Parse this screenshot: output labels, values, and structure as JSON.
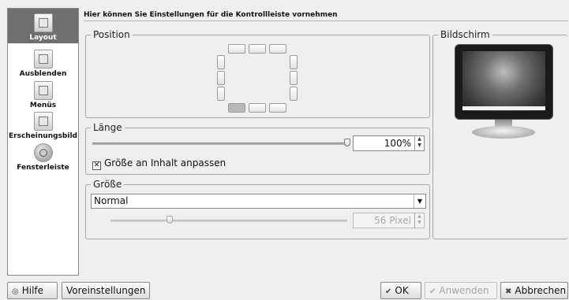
{
  "header": {
    "text": "Hier können Sie Einstellungen für die Kontrollleiste vornehmen"
  },
  "sidebar": {
    "items": [
      {
        "label": "Layout",
        "icon": "layout-icon",
        "selected": true
      },
      {
        "label": "Ausblenden",
        "icon": "hide-icon",
        "selected": false
      },
      {
        "label": "Menüs",
        "icon": "menus-icon",
        "selected": false
      },
      {
        "label": "Erscheinungsbild",
        "icon": "appearance-icon",
        "selected": false
      },
      {
        "label": "Fensterleiste",
        "icon": "taskbar-icon",
        "selected": false
      }
    ]
  },
  "position": {
    "title": "Position",
    "selected": "bottom-left"
  },
  "screen": {
    "title": "Bildschirm"
  },
  "length": {
    "title": "Länge",
    "value": "100%",
    "slider_fraction": 1.0,
    "fit_content_label": "Größe an Inhalt anpassen",
    "fit_content_checked": true
  },
  "size": {
    "title": "Größe",
    "selected": "Normal",
    "custom_value": "56 Pixel",
    "slider_fraction": 0.25
  },
  "buttons": {
    "help": "Hilfe",
    "defaults": "Voreinstellungen",
    "ok": "OK",
    "apply": "Anwenden",
    "cancel": "Abbrechen"
  }
}
